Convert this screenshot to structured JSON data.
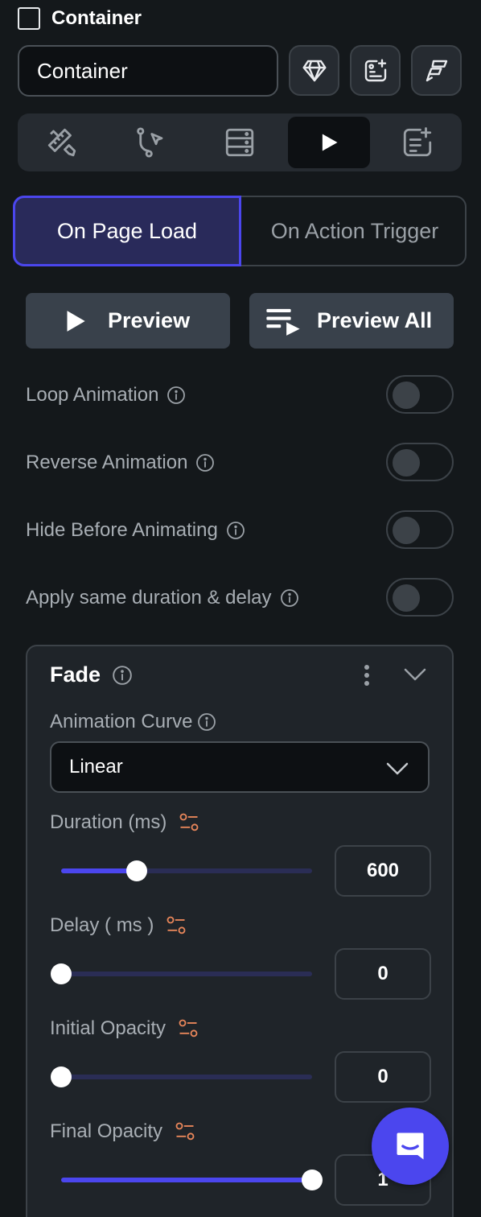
{
  "header": {
    "title": "Container",
    "checked": false
  },
  "name_field": {
    "value": "Container"
  },
  "toolbar_icons": [
    "gem-icon",
    "add-widget-icon",
    "flutterflow-icon"
  ],
  "tabs": [
    {
      "icon": "ruler-pencil-icon",
      "active": false
    },
    {
      "icon": "action-flow-icon",
      "active": false
    },
    {
      "icon": "database-icon",
      "active": false
    },
    {
      "icon": "play-icon",
      "active": true
    },
    {
      "icon": "add-notes-icon",
      "active": false
    }
  ],
  "trigger": {
    "left": "On Page Load",
    "right": "On Action Trigger",
    "selected": "On Page Load"
  },
  "preview": {
    "preview_label": "Preview",
    "preview_all_label": "Preview All"
  },
  "toggles": [
    {
      "label": "Loop Animation",
      "on": false
    },
    {
      "label": "Reverse Animation",
      "on": false
    },
    {
      "label": "Hide Before Animating",
      "on": false
    },
    {
      "label": "Apply same duration & delay",
      "on": false
    }
  ],
  "effect": {
    "title": "Fade",
    "curve_label": "Animation Curve",
    "curve_value": "Linear",
    "fields": [
      {
        "label": "Duration (ms)",
        "value": "600",
        "fraction": 0.3
      },
      {
        "label": "Delay ( ms )",
        "value": "0",
        "fraction": 0.0
      },
      {
        "label": "Initial Opacity",
        "value": "0",
        "fraction": 0.0
      },
      {
        "label": "Final Opacity",
        "value": "1",
        "fraction": 1.0
      }
    ]
  },
  "colors": {
    "accent": "#4b46ee",
    "orange_icon": "#e8865a",
    "background": "#14181b"
  }
}
